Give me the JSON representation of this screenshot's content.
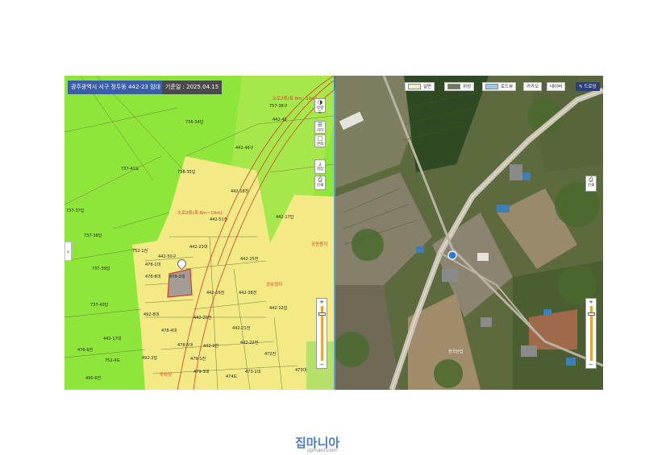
{
  "header": {
    "address": "광주광역시 서구 정두동 442-23 임대",
    "date": "기준일 : 2025.04.15"
  },
  "cadastral": {
    "parcels": [
      "736-34답",
      "442-48구",
      "737-41도",
      "736-35답",
      "442-18전",
      "737-37답",
      "442-51전",
      "442-17답",
      "737-38답",
      "752-1전",
      "442-23대",
      "442-50구",
      "442-25전",
      "737-39답",
      "478-1대",
      "478-8대",
      "479-2대",
      "442-19전",
      "442-38전",
      "442-12답",
      "737-40답",
      "492-8대",
      "442-20전",
      "478-4대",
      "442-21전",
      "442-17대",
      "752-4도",
      "478-5대",
      "442-9전",
      "442-22전",
      "492-2답",
      "479-1전",
      "476-6전",
      "479-3대",
      "472전",
      "473-1대",
      "474도",
      "490-6전",
      "473대",
      "757-38구",
      "442-45"
    ],
    "road_labels": [
      "소로2류(폭 8m~10m)",
      "소로2류(폭 8m~10m)",
      "주차장",
      "공원용지",
      "공보정지"
    ]
  },
  "tools": {
    "direction": "방향도",
    "measure": "거리",
    "area": "면적",
    "save": "저장",
    "print": "인쇄",
    "print_right": "인쇄"
  },
  "map_types": [
    "일반",
    "위성",
    "로드뷰",
    "카카오",
    "네이버",
    "드로잉"
  ],
  "satellite": {
    "place_label": "한국산업"
  },
  "footer": {
    "logo_text": "집마니아",
    "logo_url": "jipmani.com"
  },
  "colors": {
    "parcel_green": "#8fe63a",
    "parcel_yellow": "#f3ea86",
    "road_line": "#d83a2e",
    "accent_blue": "#3a5ea8"
  }
}
